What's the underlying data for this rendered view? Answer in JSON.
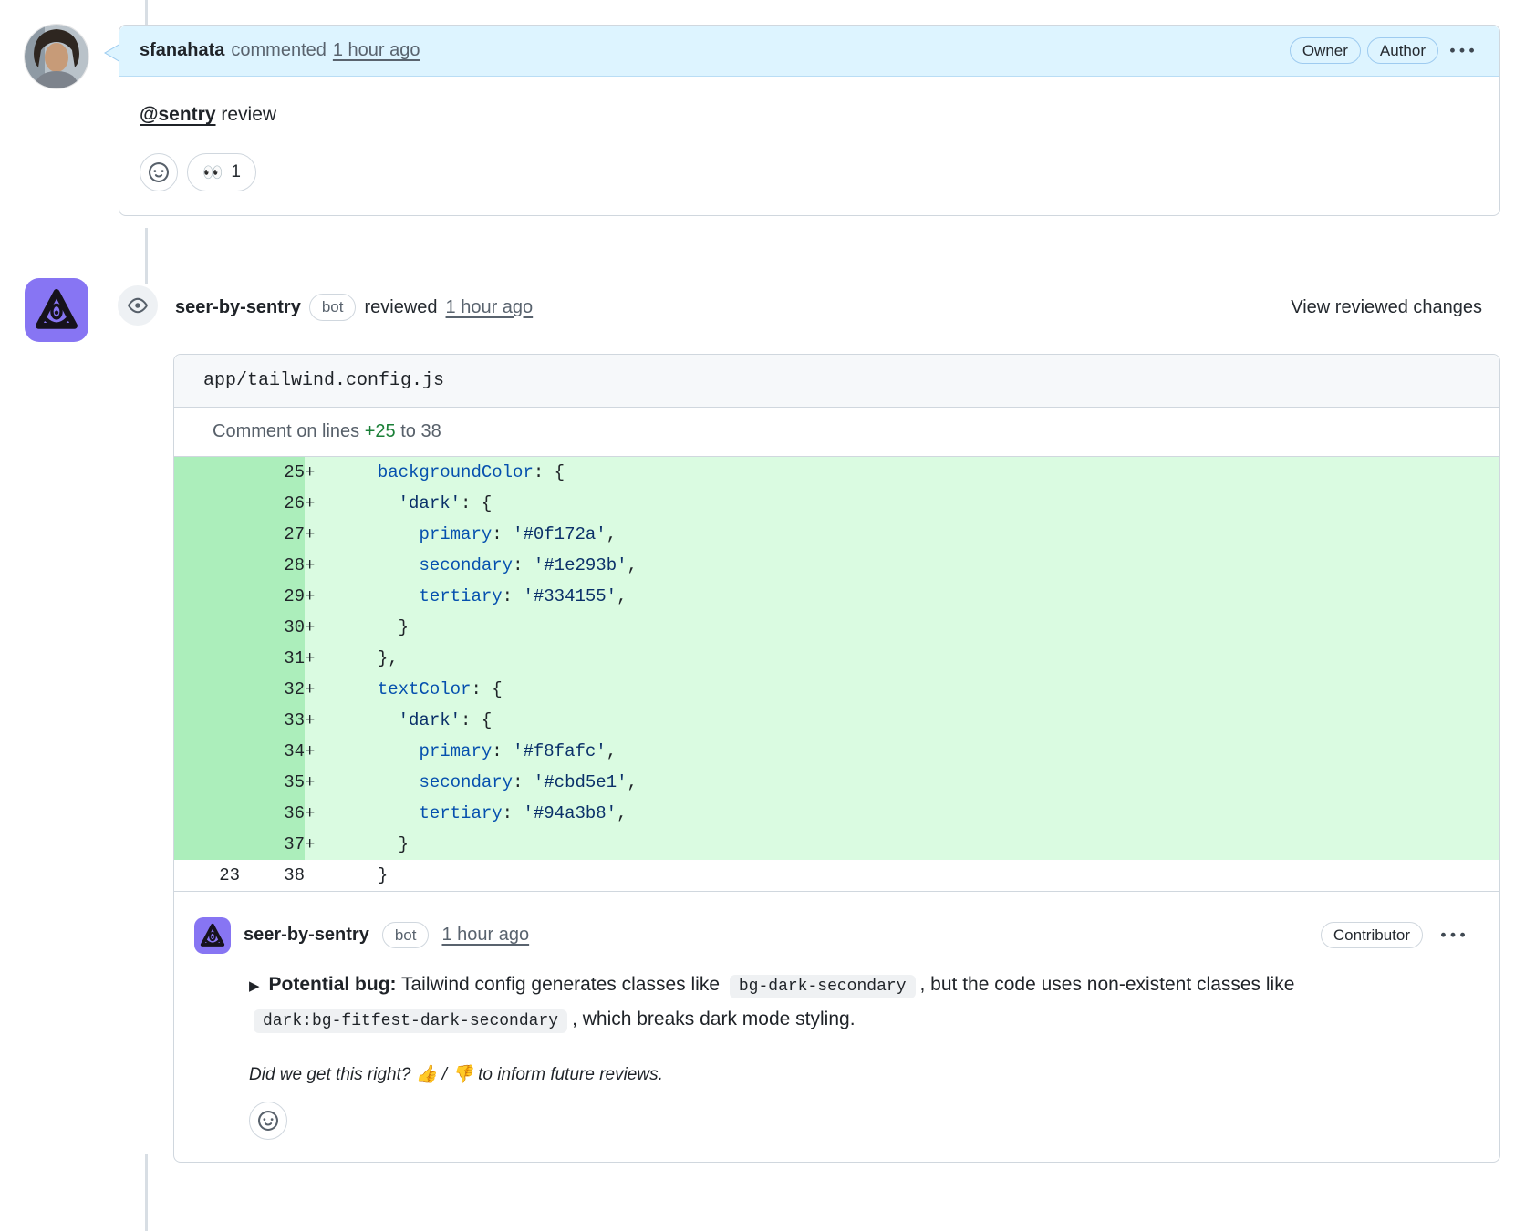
{
  "colors": {
    "comment_header_bg": "#ddf4ff",
    "addition_line_bg": "#dafbe1",
    "addition_number_bg": "#aceebb",
    "addition_accent": "#1a7f37",
    "border": "#d0d7de",
    "seer_avatar_purple": "#8775f3",
    "code_key_blue": "#0550ae",
    "code_string_navy": "#0a3069"
  },
  "icons": {
    "overflow_menu": "kebab-horizontal",
    "timeline_review": "eye",
    "add_reaction": "smiley",
    "details_marker": "▶"
  },
  "timeline_comment": {
    "author": "sfanahata",
    "action": "commented",
    "timestamp": "1 hour ago",
    "badge_owner": "Owner",
    "badge_author": "Author",
    "mention": "@sentry",
    "body_rest": " review",
    "reaction_emoji": "👀",
    "reaction_count": "1"
  },
  "review": {
    "author": "seer-by-sentry",
    "bot_badge": "bot",
    "action": "reviewed",
    "timestamp": "1 hour ago",
    "view_changes": "View reviewed changes",
    "file_path": "app/tailwind.config.js",
    "comment_on_prefix": "Comment on lines ",
    "comment_on_start": "+25",
    "comment_on_to": " to ",
    "comment_on_end": "38",
    "diff": {
      "added_lines": [
        {
          "num": "25",
          "tokens": [
            [
              "t",
              "      "
            ],
            [
              "k",
              "backgroundColor"
            ],
            [
              "t",
              ": {"
            ]
          ]
        },
        {
          "num": "26",
          "tokens": [
            [
              "t",
              "        "
            ],
            [
              "s",
              "'dark'"
            ],
            [
              "t",
              ": {"
            ]
          ]
        },
        {
          "num": "27",
          "tokens": [
            [
              "t",
              "          "
            ],
            [
              "k",
              "primary"
            ],
            [
              "t",
              ": "
            ],
            [
              "s",
              "'#0f172a'"
            ],
            [
              "t",
              ","
            ]
          ]
        },
        {
          "num": "28",
          "tokens": [
            [
              "t",
              "          "
            ],
            [
              "k",
              "secondary"
            ],
            [
              "t",
              ": "
            ],
            [
              "s",
              "'#1e293b'"
            ],
            [
              "t",
              ","
            ]
          ]
        },
        {
          "num": "29",
          "tokens": [
            [
              "t",
              "          "
            ],
            [
              "k",
              "tertiary"
            ],
            [
              "t",
              ": "
            ],
            [
              "s",
              "'#334155'"
            ],
            [
              "t",
              ","
            ]
          ]
        },
        {
          "num": "30",
          "tokens": [
            [
              "t",
              "        }"
            ]
          ]
        },
        {
          "num": "31",
          "tokens": [
            [
              "t",
              "      },"
            ]
          ]
        },
        {
          "num": "32",
          "tokens": [
            [
              "t",
              "      "
            ],
            [
              "k",
              "textColor"
            ],
            [
              "t",
              ": {"
            ]
          ]
        },
        {
          "num": "33",
          "tokens": [
            [
              "t",
              "        "
            ],
            [
              "s",
              "'dark'"
            ],
            [
              "t",
              ": {"
            ]
          ]
        },
        {
          "num": "34",
          "tokens": [
            [
              "t",
              "          "
            ],
            [
              "k",
              "primary"
            ],
            [
              "t",
              ": "
            ],
            [
              "s",
              "'#f8fafc'"
            ],
            [
              "t",
              ","
            ]
          ]
        },
        {
          "num": "35",
          "tokens": [
            [
              "t",
              "          "
            ],
            [
              "k",
              "secondary"
            ],
            [
              "t",
              ": "
            ],
            [
              "s",
              "'#cbd5e1'"
            ],
            [
              "t",
              ","
            ]
          ]
        },
        {
          "num": "36",
          "tokens": [
            [
              "t",
              "          "
            ],
            [
              "k",
              "tertiary"
            ],
            [
              "t",
              ": "
            ],
            [
              "s",
              "'#94a3b8'"
            ],
            [
              "t",
              ","
            ]
          ]
        },
        {
          "num": "37",
          "tokens": [
            [
              "t",
              "        }"
            ]
          ]
        }
      ],
      "context_line": {
        "old_num": "23",
        "new_num": "38",
        "tokens": [
          [
            "t",
            "      }"
          ]
        ]
      }
    }
  },
  "inline_comment": {
    "author": "seer-by-sentry",
    "bot_badge": "bot",
    "timestamp": "1 hour ago",
    "badge_contributor": "Contributor",
    "disclosure": "▶",
    "title": "Potential bug:",
    "text_1": " Tailwind config generates classes like ",
    "code_1": "bg-dark-secondary",
    "text_2": ", but the code uses non-existent classes like ",
    "code_2": "dark:bg-fitfest-dark-secondary",
    "text_3": ", which breaks dark mode styling.",
    "footer_text_1": "Did we get this right? ",
    "footer_emojis": "👍 / 👎",
    "footer_text_2": " to inform future reviews."
  }
}
